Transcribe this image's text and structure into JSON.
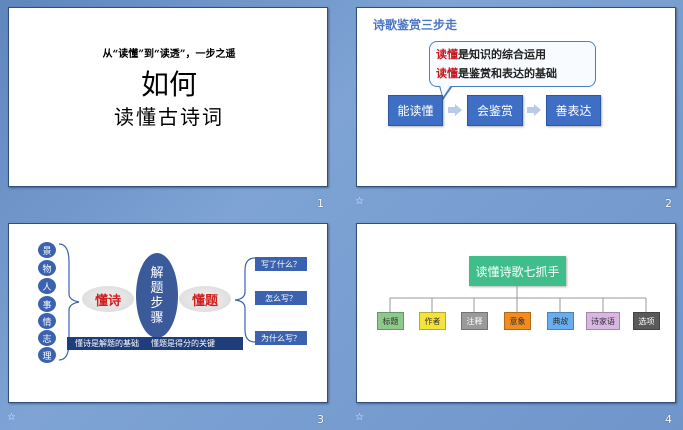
{
  "slides": [
    {
      "number": "1",
      "subtitle": "从“读懂”到“读透”，一步之遥",
      "title_line1": "如何",
      "title_line2": "读懂古诗词"
    },
    {
      "number": "2",
      "heading": "诗歌鉴赏三步走",
      "bubble": [
        {
          "highlight": "读懂",
          "rest": "是知识的综合运用"
        },
        {
          "highlight": "读懂",
          "rest": "是鉴赏和表达的基础"
        }
      ],
      "steps": [
        "能读懂",
        "会鉴赏",
        "善表达"
      ],
      "colors": {
        "step": "#3e6fc4",
        "arrow": "#b8cbe8",
        "heading": "#4a76c6"
      }
    },
    {
      "number": "3",
      "vertical_items": [
        "景",
        "物",
        "人",
        "事",
        "情",
        "志",
        "理"
      ],
      "left_label": "懂诗",
      "center_label": [
        "解",
        "题",
        "步",
        "骤"
      ],
      "right_label": "懂题",
      "questions": [
        "写了什么？",
        "怎么写？",
        "为什么写？"
      ],
      "bottom_text_1": "懂诗是解题的基础",
      "bottom_text_2": "懂题是得分的关键"
    },
    {
      "number": "4",
      "root": "读懂诗歌七抓手",
      "leaves": [
        {
          "label": "标题",
          "color": "#8cc98a"
        },
        {
          "label": "作者",
          "color": "#f4e33b"
        },
        {
          "label": "注释",
          "color": "#9a9a9a"
        },
        {
          "label": "意象",
          "color": "#f28c1e"
        },
        {
          "label": "典故",
          "color": "#66aef0"
        },
        {
          "label": "诗家语",
          "color": "#d9b6e3"
        },
        {
          "label": "选项",
          "color": "#5a5a5a"
        }
      ]
    }
  ],
  "star_glyph": "☆"
}
